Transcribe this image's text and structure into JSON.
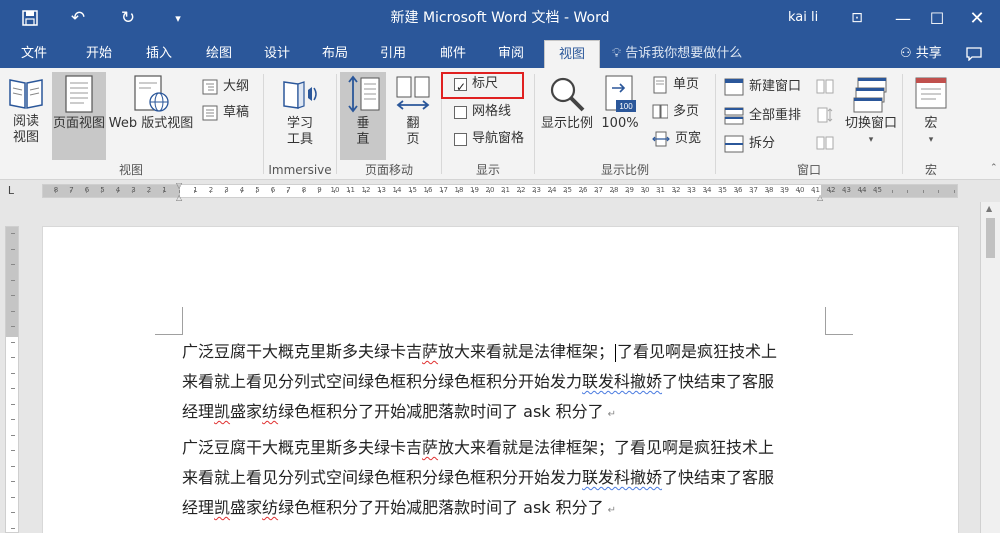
{
  "window": {
    "title": "新建 Microsoft Word 文档 - Word",
    "user": "kai li"
  },
  "tabs": [
    "文件",
    "开始",
    "插入",
    "绘图",
    "设计",
    "布局",
    "引用",
    "邮件",
    "审阅",
    "视图"
  ],
  "active_tab": "视图",
  "tell_me": "告诉我你想要做什么",
  "share": "共享",
  "ribbon": {
    "view_group": {
      "label": "视图",
      "read_mode": [
        "阅读",
        "视图"
      ],
      "print_layout": "页面视图",
      "web_layout": "Web 版式视图",
      "outline": "大纲",
      "draft": "草稿"
    },
    "immersive_group": {
      "label": "Immersive",
      "learning_tools": [
        "学习",
        "工具"
      ]
    },
    "page_movement_group": {
      "label": "页面移动",
      "vertical": [
        "垂",
        "直"
      ],
      "side_to_side": [
        "翻",
        "页"
      ]
    },
    "show_group": {
      "label": "显示",
      "ruler": "标尺",
      "ruler_checked": true,
      "gridlines": "网格线",
      "gridlines_checked": false,
      "nav_pane": "导航窗格",
      "nav_pane_checked": false
    },
    "zoom_group": {
      "label": "显示比例",
      "zoom": "显示比例",
      "zoom_100": "100%",
      "zoom_100_icon_text": "100",
      "one_page": "单页",
      "multiple_pages": "多页",
      "page_width": "页宽"
    },
    "window_group": {
      "label": "窗口",
      "new_window": "新建窗口",
      "arrange_all": "全部重排",
      "split": "拆分",
      "switch_windows": "切换窗口"
    },
    "macros_group": {
      "label": "宏",
      "macros": "宏"
    }
  },
  "ruler": {
    "tab_selector": "L",
    "left_numbers": [
      "8",
      "7",
      "6",
      "5",
      "4",
      "3",
      "2",
      "1"
    ],
    "right_numbers": [
      "1",
      "2",
      "3",
      "4",
      "5",
      "6",
      "7",
      "8",
      "9",
      "10",
      "11",
      "12",
      "13",
      "14",
      "15",
      "16",
      "17",
      "18",
      "19",
      "20",
      "21",
      "22",
      "23",
      "24",
      "25",
      "26",
      "27",
      "28",
      "29",
      "30",
      "31",
      "32",
      "33",
      "34",
      "35",
      "36",
      "37",
      "38",
      "39",
      "40",
      "41",
      "42",
      "43",
      "44",
      "45"
    ]
  },
  "document": {
    "paragraphs": [
      {
        "lines": [
          {
            "pre": "广泛豆腐干大概克里斯多夫绿卡吉",
            "w1": "萨",
            "mid": "放大来看就是法律框架；",
            "caret": true,
            "post": "了看见啊是疯狂技术上"
          },
          {
            "pre": "来看就上看见分列式空间绿色框积分绿色框积分开始发力",
            "w2": "联发科撤娇",
            "post": "了快结束了客服"
          },
          {
            "pre": "经理",
            "w1": "凯",
            "mid": "盛家",
            "w1b": "纺",
            "post": "绿色框积分了开始减肥落款时间了 ask 积分了"
          }
        ]
      },
      {
        "lines": [
          {
            "pre": "广泛豆腐干大概克里斯多夫绿卡吉",
            "w1": "萨",
            "mid": "放大来看就是法律框架；了看见啊是疯狂技术上",
            "post": ""
          },
          {
            "pre": "来看就上看见分列式空间绿色框积分绿色框积分开始发力",
            "w2": "联发科撤娇",
            "post": "了快结束了客服"
          },
          {
            "pre": "经理",
            "w1": "凯",
            "mid": "盛家",
            "w1b": "纺",
            "post": "绿色框积分了开始减肥落款时间了 ask 积分了"
          }
        ]
      }
    ],
    "paragraph_mark": "↵"
  }
}
